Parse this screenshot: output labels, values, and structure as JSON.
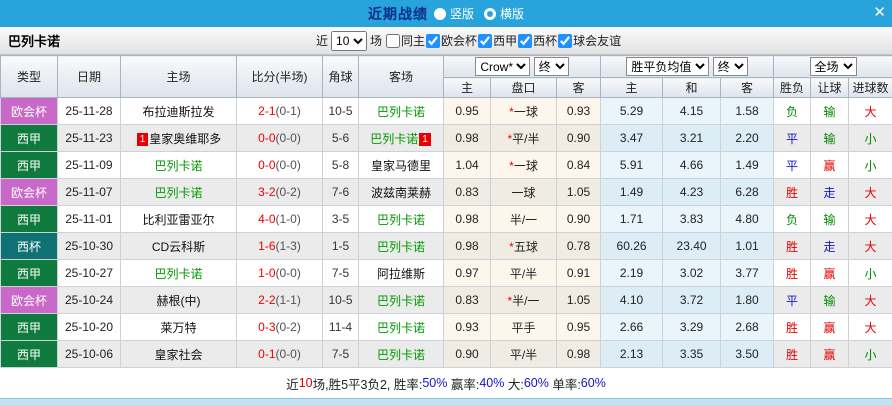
{
  "topbar": {
    "title": "近期战绩",
    "radios": [
      {
        "label": "竖版",
        "selected": true
      },
      {
        "label": "横版",
        "selected": false
      }
    ],
    "close": "✕"
  },
  "filterbar": {
    "team": "巴列卡诺",
    "near_label": "近",
    "games_value": "10",
    "games_label": "场",
    "checks": [
      {
        "label": "同主",
        "checked": false
      },
      {
        "label": "欧会杯",
        "checked": true
      },
      {
        "label": "西甲",
        "checked": true
      },
      {
        "label": "西杯",
        "checked": true
      },
      {
        "label": "球会友谊",
        "checked": true
      }
    ]
  },
  "header": {
    "cols": [
      "类型",
      "日期",
      "主场",
      "比分(半场)",
      "角球",
      "客场"
    ],
    "selects": {
      "crow": "Crow*",
      "crow_final": "终",
      "avg": "胜平负均值",
      "avg_final": "终",
      "scope": "全场"
    },
    "sub": [
      "主",
      "盘口",
      "客",
      "主",
      "和",
      "客",
      "胜负",
      "让球",
      "进球数"
    ]
  },
  "rows": [
    {
      "type": {
        "label": "欧会杯",
        "cls": "purple"
      },
      "date": "25-11-28",
      "home": {
        "name": "布拉迪斯拉发",
        "self": false,
        "badge": null
      },
      "score": {
        "ft": "2-1",
        "ht": "(0-1)"
      },
      "corners": "10-5",
      "away": {
        "name": "巴列卡诺",
        "self": true,
        "badge": null
      },
      "crow": {
        "h": "0.95",
        "star": true,
        "handicap": "一球",
        "a": "0.93"
      },
      "avg": {
        "h": "5.29",
        "d": "4.15",
        "a": "1.58"
      },
      "spf": {
        "t": "负",
        "c": "green"
      },
      "rq": {
        "t": "输",
        "c": "green"
      },
      "jq": {
        "t": "大",
        "c": "red"
      }
    },
    {
      "type": {
        "label": "西甲",
        "cls": "green"
      },
      "date": "25-11-23",
      "home": {
        "name": "皇家奥维耶多",
        "self": false,
        "badge": "1"
      },
      "score": {
        "ft": "0-0",
        "ht": "(0-0)"
      },
      "corners": "5-6",
      "away": {
        "name": "巴列卡诺",
        "self": true,
        "badge": "1"
      },
      "crow": {
        "h": "0.98",
        "star": true,
        "handicap": "平/半",
        "a": "0.90"
      },
      "avg": {
        "h": "3.47",
        "d": "3.21",
        "a": "2.20"
      },
      "spf": {
        "t": "平",
        "c": "blue"
      },
      "rq": {
        "t": "输",
        "c": "green"
      },
      "jq": {
        "t": "小",
        "c": "green"
      }
    },
    {
      "type": {
        "label": "西甲",
        "cls": "green"
      },
      "date": "25-11-09",
      "home": {
        "name": "巴列卡诺",
        "self": true,
        "badge": null
      },
      "score": {
        "ft": "0-0",
        "ht": "(0-0)"
      },
      "corners": "5-8",
      "away": {
        "name": "皇家马德里",
        "self": false,
        "badge": null
      },
      "crow": {
        "h": "1.04",
        "star": true,
        "handicap": "一球",
        "a": "0.84"
      },
      "avg": {
        "h": "5.91",
        "d": "4.66",
        "a": "1.49"
      },
      "spf": {
        "t": "平",
        "c": "blue"
      },
      "rq": {
        "t": "赢",
        "c": "red"
      },
      "jq": {
        "t": "小",
        "c": "green"
      }
    },
    {
      "type": {
        "label": "欧会杯",
        "cls": "purple"
      },
      "date": "25-11-07",
      "home": {
        "name": "巴列卡诺",
        "self": true,
        "badge": null
      },
      "score": {
        "ft": "3-2",
        "ht": "(0-2)"
      },
      "corners": "7-6",
      "away": {
        "name": "波兹南莱赫",
        "self": false,
        "badge": null
      },
      "crow": {
        "h": "0.83",
        "star": false,
        "handicap": "一球",
        "a": "1.05"
      },
      "avg": {
        "h": "1.49",
        "d": "4.23",
        "a": "6.28"
      },
      "spf": {
        "t": "胜",
        "c": "red"
      },
      "rq": {
        "t": "走",
        "c": "blue"
      },
      "jq": {
        "t": "大",
        "c": "red"
      }
    },
    {
      "type": {
        "label": "西甲",
        "cls": "green"
      },
      "date": "25-11-01",
      "home": {
        "name": "比利亚雷亚尔",
        "self": false,
        "badge": null
      },
      "score": {
        "ft": "4-0",
        "ht": "(1-0)"
      },
      "corners": "3-5",
      "away": {
        "name": "巴列卡诺",
        "self": true,
        "badge": null
      },
      "crow": {
        "h": "0.98",
        "star": false,
        "handicap": "半/一",
        "a": "0.90"
      },
      "avg": {
        "h": "1.71",
        "d": "3.83",
        "a": "4.80"
      },
      "spf": {
        "t": "负",
        "c": "green"
      },
      "rq": {
        "t": "输",
        "c": "green"
      },
      "jq": {
        "t": "大",
        "c": "red"
      }
    },
    {
      "type": {
        "label": "西杯",
        "cls": "teal"
      },
      "date": "25-10-30",
      "home": {
        "name": "CD云科斯",
        "self": false,
        "badge": null
      },
      "score": {
        "ft": "1-6",
        "ht": "(1-3)"
      },
      "corners": "1-5",
      "away": {
        "name": "巴列卡诺",
        "self": true,
        "badge": null
      },
      "crow": {
        "h": "0.98",
        "star": true,
        "handicap": "五球",
        "a": "0.78"
      },
      "avg": {
        "h": "60.26",
        "d": "23.40",
        "a": "1.01"
      },
      "spf": {
        "t": "胜",
        "c": "red"
      },
      "rq": {
        "t": "走",
        "c": "blue"
      },
      "jq": {
        "t": "大",
        "c": "red"
      }
    },
    {
      "type": {
        "label": "西甲",
        "cls": "green"
      },
      "date": "25-10-27",
      "home": {
        "name": "巴列卡诺",
        "self": true,
        "badge": null
      },
      "score": {
        "ft": "1-0",
        "ht": "(0-0)"
      },
      "corners": "7-5",
      "away": {
        "name": "阿拉维斯",
        "self": false,
        "badge": null
      },
      "crow": {
        "h": "0.97",
        "star": false,
        "handicap": "平/半",
        "a": "0.91"
      },
      "avg": {
        "h": "2.19",
        "d": "3.02",
        "a": "3.77"
      },
      "spf": {
        "t": "胜",
        "c": "red"
      },
      "rq": {
        "t": "赢",
        "c": "red"
      },
      "jq": {
        "t": "小",
        "c": "green"
      }
    },
    {
      "type": {
        "label": "欧会杯",
        "cls": "purple"
      },
      "date": "25-10-24",
      "home": {
        "name": "赫根(中)",
        "self": false,
        "badge": null
      },
      "score": {
        "ft": "2-2",
        "ht": "(1-1)"
      },
      "corners": "10-5",
      "away": {
        "name": "巴列卡诺",
        "self": true,
        "badge": null
      },
      "crow": {
        "h": "0.83",
        "star": true,
        "handicap": "半/一",
        "a": "1.05"
      },
      "avg": {
        "h": "4.10",
        "d": "3.72",
        "a": "1.80"
      },
      "spf": {
        "t": "平",
        "c": "blue"
      },
      "rq": {
        "t": "输",
        "c": "green"
      },
      "jq": {
        "t": "大",
        "c": "red"
      }
    },
    {
      "type": {
        "label": "西甲",
        "cls": "green"
      },
      "date": "25-10-20",
      "home": {
        "name": "莱万特",
        "self": false,
        "badge": null
      },
      "score": {
        "ft": "0-3",
        "ht": "(0-2)"
      },
      "corners": "11-4",
      "away": {
        "name": "巴列卡诺",
        "self": true,
        "badge": null
      },
      "crow": {
        "h": "0.93",
        "star": false,
        "handicap": "平手",
        "a": "0.95"
      },
      "avg": {
        "h": "2.66",
        "d": "3.29",
        "a": "2.68"
      },
      "spf": {
        "t": "胜",
        "c": "red"
      },
      "rq": {
        "t": "赢",
        "c": "red"
      },
      "jq": {
        "t": "大",
        "c": "red"
      }
    },
    {
      "type": {
        "label": "西甲",
        "cls": "green"
      },
      "date": "25-10-06",
      "home": {
        "name": "皇家社会",
        "self": false,
        "badge": null
      },
      "score": {
        "ft": "0-1",
        "ht": "(0-0)"
      },
      "corners": "7-5",
      "away": {
        "name": "巴列卡诺",
        "self": true,
        "badge": null
      },
      "crow": {
        "h": "0.90",
        "star": false,
        "handicap": "平/半",
        "a": "0.98"
      },
      "avg": {
        "h": "2.13",
        "d": "3.35",
        "a": "3.50"
      },
      "spf": {
        "t": "胜",
        "c": "red"
      },
      "rq": {
        "t": "赢",
        "c": "red"
      },
      "jq": {
        "t": "小",
        "c": "green"
      }
    }
  ],
  "footer": {
    "segments": [
      {
        "text": "近"
      },
      {
        "text": "10",
        "c": "red"
      },
      {
        "text": "场,胜5平3负2, 胜率:"
      },
      {
        "text": "50%",
        "c": "blue"
      },
      {
        "text": " 赢率:"
      },
      {
        "text": "40%",
        "c": "blue"
      },
      {
        "text": " 大:"
      },
      {
        "text": "60%",
        "c": "blue"
      },
      {
        "text": " 单率:"
      },
      {
        "text": "60%",
        "c": "blue"
      }
    ]
  },
  "colors": {
    "topbar": "#29A3DB",
    "title": "#0A2E8C",
    "league_europa_conference": "#C868C8",
    "league_laliga": "#0F7A3D",
    "league_copa": "#0E7173",
    "self_team_green": "#009900",
    "score_red": "#F00000",
    "win_red": "#E60000",
    "lose_green": "#008800",
    "draw_blue": "#1414CC",
    "check_blue": "#1E90FF"
  }
}
